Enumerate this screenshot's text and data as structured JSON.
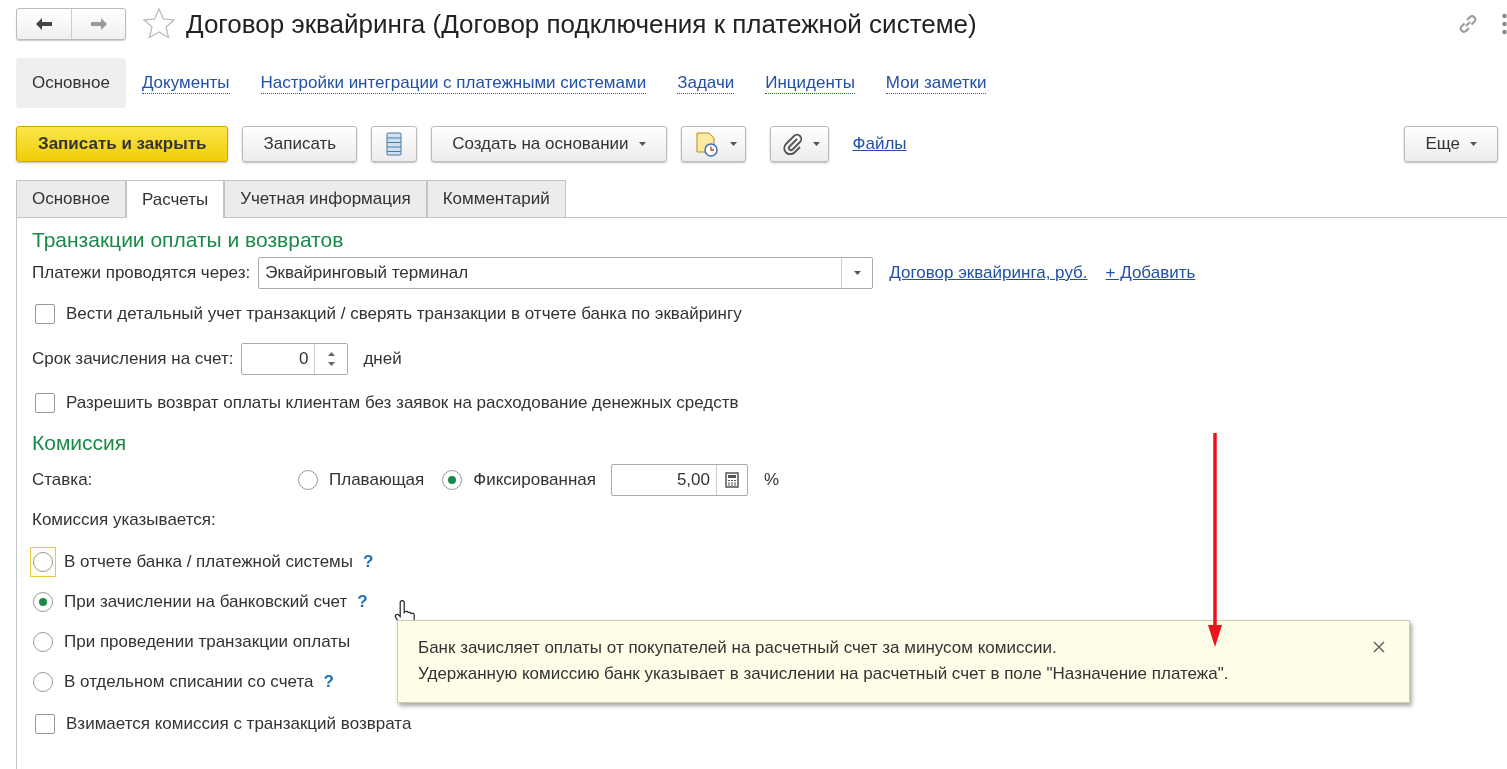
{
  "window": {
    "title": "Договор эквайринга (Договор подключения к платежной системе)"
  },
  "nav": [
    {
      "kind": "back",
      "disabled": false
    },
    {
      "kind": "forward",
      "disabled": true
    }
  ],
  "sections": [
    {
      "label": "Основное",
      "selected": true
    },
    {
      "label": "Документы",
      "selected": false
    },
    {
      "label": "Настройки интеграции с платежными системами",
      "selected": false
    },
    {
      "label": "Задачи",
      "selected": false
    },
    {
      "label": "Инциденты",
      "selected": false
    },
    {
      "label": "Мои заметки",
      "selected": false
    }
  ],
  "toolbar": [
    {
      "kind": "primary",
      "label": "Записать и закрыть"
    },
    {
      "kind": "button",
      "label": "Записать"
    },
    {
      "kind": "list"
    },
    {
      "kind": "dropdown",
      "label": "Создать на основании"
    },
    {
      "kind": "report"
    },
    {
      "kind": "attach"
    },
    {
      "kind": "link",
      "label": "Файлы"
    },
    {
      "kind": "more",
      "label": "Еще"
    }
  ],
  "tabs": [
    {
      "label": "Основное",
      "selected": false
    },
    {
      "label": "Расчеты",
      "selected": true
    },
    {
      "label": "Учетная информация",
      "selected": false
    },
    {
      "label": "Комментарий",
      "selected": false
    }
  ],
  "payments": {
    "title": "Транзакции оплаты и возвратов",
    "via_label": "Платежи проводятся через:",
    "via_value": "Эквайринговый терминал",
    "contract_link": "Договор эквайринга, руб.",
    "add_link": "+ Добавить",
    "detailed": {
      "label": "Вести детальный учет транзакций / сверять транзакции в отчете банка по эквайрингу",
      "checked": false
    },
    "term_label": "Срок зачисления на счет:",
    "term_value": "0",
    "term_unit": "дней",
    "allow_refund": {
      "label": "Разрешить возврат оплаты клиентам без заявок на расходование денежных средств",
      "checked": false
    }
  },
  "commission": {
    "title": "Комиссия",
    "rate_label": "Ставка:",
    "rate_options": [
      {
        "label": "Плавающая",
        "selected": false
      },
      {
        "label": "Фиксированная",
        "selected": true
      }
    ],
    "rate_value": "5,00",
    "rate_unit": "%",
    "specified_label": "Комиссия указывается:",
    "sources": [
      {
        "label": "В отчете банка / платежной системы",
        "selected": false,
        "focused": true,
        "help": "?"
      },
      {
        "label": "При зачислении на банковский счет",
        "selected": true,
        "focused": false,
        "help": "?"
      },
      {
        "label": "При проведении транзакции оплаты",
        "selected": false,
        "focused": false
      },
      {
        "label": "В отдельном списании со счета",
        "selected": false,
        "focused": false,
        "help": "?"
      }
    ],
    "refund_commission": {
      "label": "Взимается комиссия с транзакций возврата",
      "checked": false
    }
  },
  "tooltip": {
    "lines": [
      "Банк зачисляет оплаты от покупателей на расчетный счет за минусом комиссии.",
      "Удержанную комиссию банк указывает в зачислении на расчетный счет в поле \"Назначение платежа\"."
    ]
  }
}
